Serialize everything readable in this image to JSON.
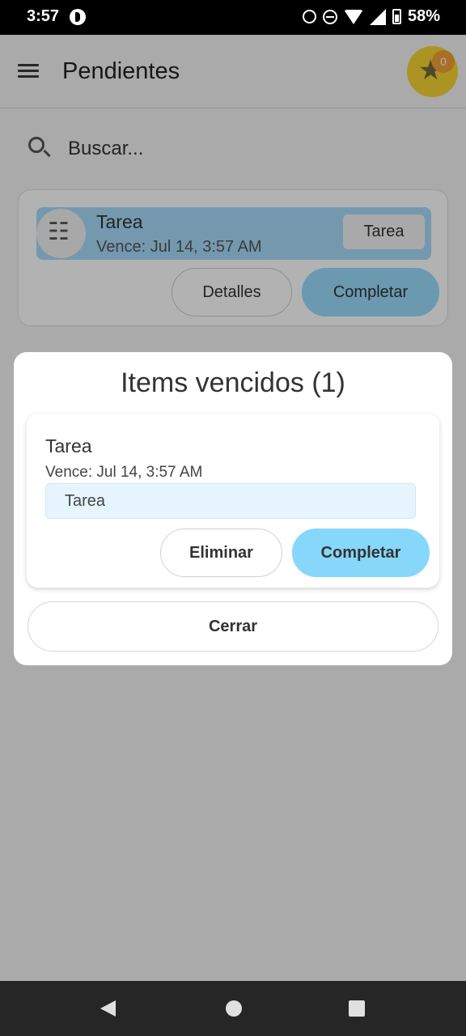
{
  "status_bar": {
    "time": "3:57",
    "battery": "58%"
  },
  "app_bar": {
    "title": "Pendientes",
    "star_count": "0"
  },
  "search": {
    "placeholder": "Buscar..."
  },
  "task_card": {
    "title": "Tarea",
    "due": "Vence: Jul 14, 3:57 AM",
    "chip": "Tarea",
    "details_label": "Detalles",
    "complete_label": "Completar"
  },
  "dialog": {
    "title": "Items vencidos (1)",
    "item": {
      "title": "Tarea",
      "due": "Vence: Jul 14, 3:57 AM",
      "chip": "Tarea",
      "delete_label": "Eliminar",
      "complete_label": "Completar"
    },
    "close_label": "Cerrar"
  },
  "colors": {
    "accent": "#87d7fb",
    "task_header": "#a6dcfb",
    "star_badge": "#f5d334",
    "count_badge": "#f0a136"
  },
  "icons": {
    "menu": "menu-icon",
    "star": "star-icon",
    "search": "search-icon",
    "task": "checklist-icon"
  }
}
